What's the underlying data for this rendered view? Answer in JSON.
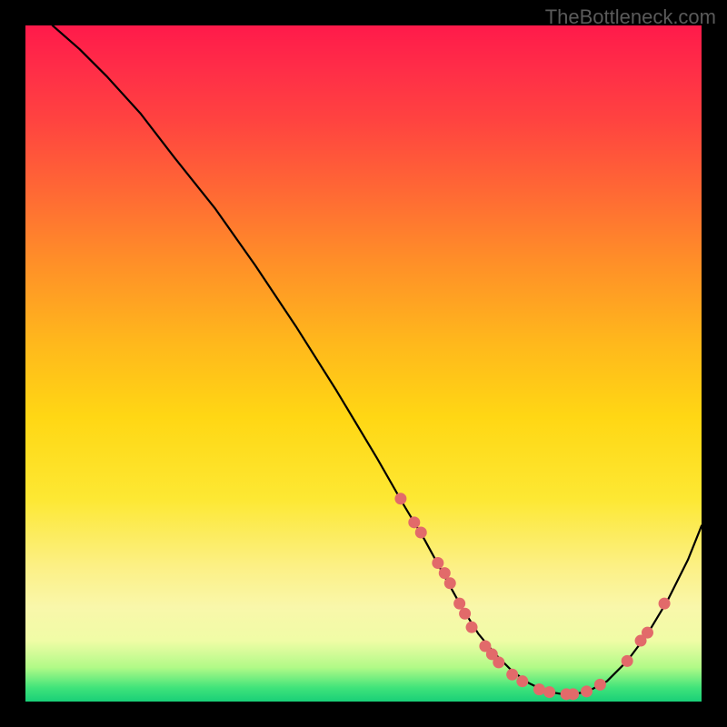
{
  "watermark": "TheBottleneck.com",
  "chart_data": {
    "type": "line",
    "title": "",
    "xlabel": "",
    "ylabel": "",
    "xlim": [
      0,
      100
    ],
    "ylim": [
      0,
      100
    ],
    "curve": {
      "x": [
        4,
        8,
        12,
        17,
        22,
        28,
        34,
        40,
        46,
        52,
        56,
        59,
        62,
        64.5,
        67,
        69.5,
        72,
        74.5,
        77,
        80,
        83,
        86,
        89,
        92,
        95,
        98,
        100
      ],
      "y": [
        100,
        96.5,
        92.5,
        87,
        80.5,
        73,
        64.5,
        55.5,
        46,
        36,
        29,
        24,
        18.5,
        14,
        10,
        7,
        4.5,
        2.7,
        1.5,
        1,
        1.4,
        3,
        6,
        10,
        15,
        21,
        26
      ]
    },
    "markers": [
      {
        "x": 55.5,
        "y": 30
      },
      {
        "x": 57.5,
        "y": 26.5
      },
      {
        "x": 58.5,
        "y": 25
      },
      {
        "x": 61,
        "y": 20.5
      },
      {
        "x": 62,
        "y": 19
      },
      {
        "x": 62.8,
        "y": 17.5
      },
      {
        "x": 64.2,
        "y": 14.5
      },
      {
        "x": 65,
        "y": 13
      },
      {
        "x": 66,
        "y": 11
      },
      {
        "x": 68,
        "y": 8.2
      },
      {
        "x": 69,
        "y": 7
      },
      {
        "x": 70,
        "y": 5.8
      },
      {
        "x": 72,
        "y": 4
      },
      {
        "x": 73.5,
        "y": 3
      },
      {
        "x": 76,
        "y": 1.8
      },
      {
        "x": 77.5,
        "y": 1.4
      },
      {
        "x": 80,
        "y": 1.1
      },
      {
        "x": 81,
        "y": 1.1
      },
      {
        "x": 83,
        "y": 1.5
      },
      {
        "x": 85,
        "y": 2.5
      },
      {
        "x": 89,
        "y": 6
      },
      {
        "x": 91,
        "y": 9
      },
      {
        "x": 92,
        "y": 10.2
      },
      {
        "x": 94.5,
        "y": 14.5
      }
    ],
    "gradient_stops": [
      {
        "offset": 0,
        "color": "#ff1a4a"
      },
      {
        "offset": 50,
        "color": "#ffd714"
      },
      {
        "offset": 100,
        "color": "#19cf78"
      }
    ]
  }
}
